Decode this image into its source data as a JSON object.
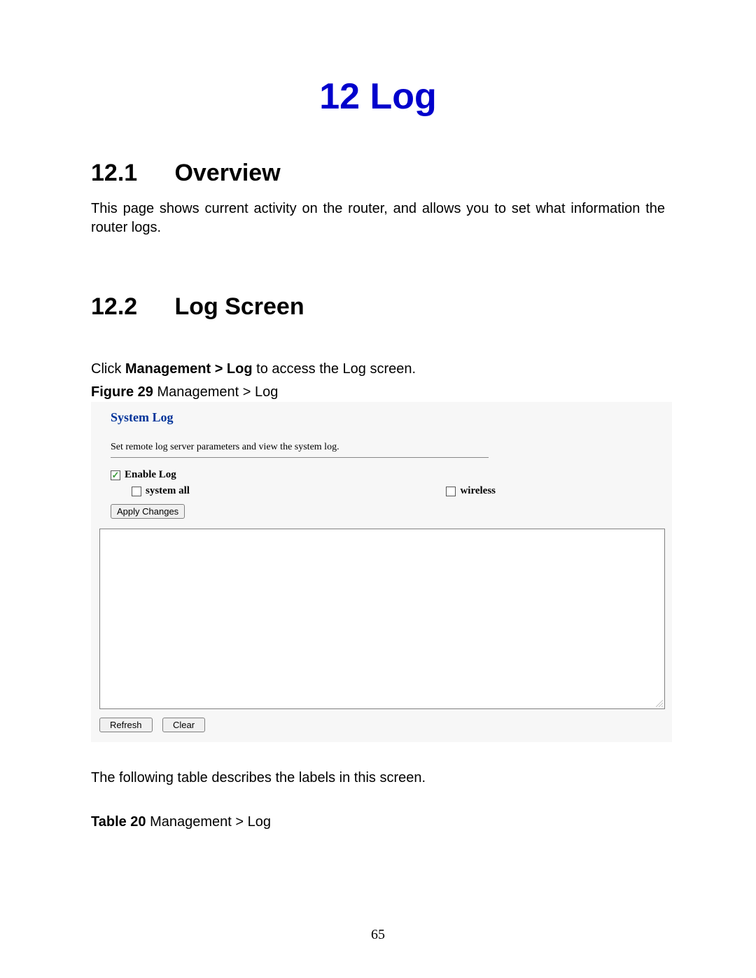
{
  "chapter": {
    "number": "12",
    "title": "Log"
  },
  "section1": {
    "number": "12.1",
    "title": "Overview",
    "body": "This page shows current activity on the router, and allows you to set what information the router logs."
  },
  "section2": {
    "number": "12.2",
    "title": "Log Screen",
    "instruction_prefix": "Click ",
    "instruction_bold": "Management > Log",
    "instruction_suffix": " to access the Log screen."
  },
  "figure": {
    "label": "Figure 29",
    "caption": " Management > Log"
  },
  "screenshot": {
    "title": "System Log",
    "description": "Set remote log server parameters and view the system log.",
    "enable_log": "Enable Log",
    "system_all": "system all",
    "wireless": "wireless",
    "apply_btn": "Apply Changes",
    "refresh_btn": "Refresh",
    "clear_btn": "Clear",
    "enable_log_checked": true,
    "system_all_checked": false,
    "wireless_checked": false
  },
  "after_figure": "The following table describes the labels in this screen.",
  "table": {
    "label": "Table 20",
    "caption": "  Management > Log"
  },
  "page_number": "65"
}
